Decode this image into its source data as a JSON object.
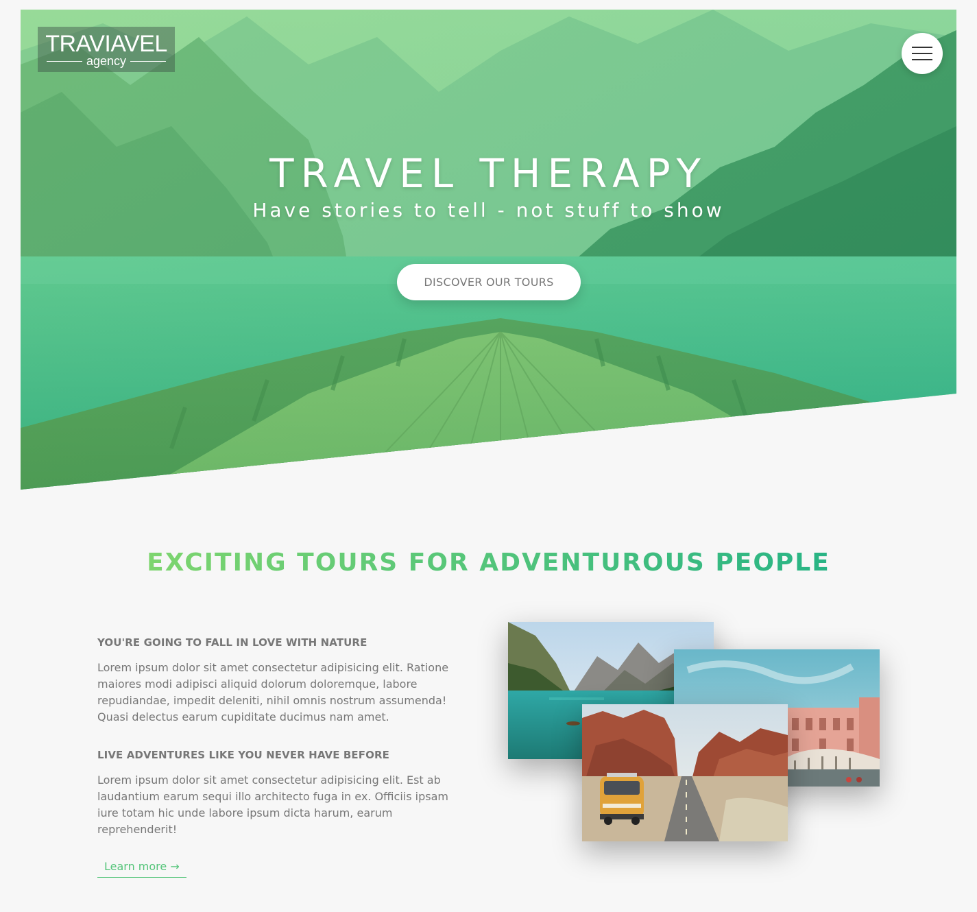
{
  "header": {
    "logo": {
      "main": "TRAVIAVEL",
      "sub": "agency"
    },
    "title": "TRAVEL THERAPY",
    "subtitle": "Have stories to tell - not stuff to show",
    "cta_label": "DISCOVER OUR TOURS"
  },
  "about": {
    "title": "EXCITING TOURS FOR ADVENTUROUS PEOPLE",
    "blocks": [
      {
        "heading": "YOU'RE GOING TO FALL IN LOVE WITH NATURE",
        "text": "Lorem ipsum dolor sit amet consectetur adipisicing elit. Ratione maiores modi adipisci aliquid dolorum doloremque, labore repudiandae, impedit deleniti, nihil omnis nostrum assumenda! Quasi delectus earum cupiditate ducimus nam amet."
      },
      {
        "heading": "LIVE ADVENTURES LIKE YOU NEVER HAVE BEFORE",
        "text": "Lorem ipsum dolor sit amet consectetur adipisicing elit. Est ab laudantium earum sequi illo architecto fuga in ex. Officiis ipsam iure totam hic unde labore ipsum dicta harum, earum reprehenderit!"
      }
    ],
    "link_label": "Learn more →",
    "photos": [
      "mountain-lake-photo",
      "venice-canal-photo",
      "desert-road-van-photo"
    ]
  },
  "colors": {
    "accent_light": "#7ed56f",
    "accent_dark": "#28b485",
    "text": "#777777",
    "background": "#f7f7f7"
  },
  "icons": {
    "menu": "hamburger-menu-icon"
  }
}
